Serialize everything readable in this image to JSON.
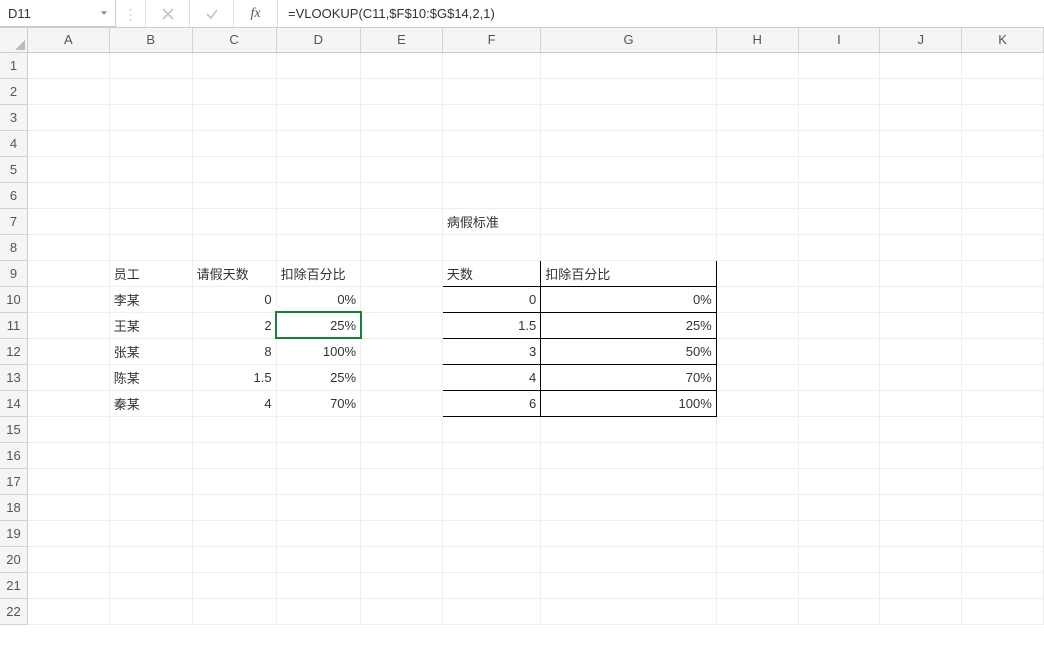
{
  "nameBox": "D11",
  "formula": "=VLOOKUP(C11,$F$10:$G$14,2,1)",
  "columns": [
    "A",
    "B",
    "C",
    "D",
    "E",
    "F",
    "G",
    "H",
    "I",
    "J",
    "K"
  ],
  "rowCount": 22,
  "selectedCell": {
    "row": 11,
    "col": "D"
  },
  "cells": {
    "F7": {
      "v": "病假标准",
      "align": "left"
    },
    "B9": {
      "v": "员工",
      "align": "left"
    },
    "C9": {
      "v": "请假天数",
      "align": "left"
    },
    "D9": {
      "v": "扣除百分比",
      "align": "left"
    },
    "F9": {
      "v": "天数",
      "align": "left",
      "border": [
        "bt",
        "bl",
        "br",
        "bb"
      ]
    },
    "G9": {
      "v": "扣除百分比",
      "align": "left",
      "border": [
        "bt",
        "br",
        "bb"
      ]
    },
    "B10": {
      "v": "李某",
      "align": "left"
    },
    "C10": {
      "v": "0",
      "align": "right"
    },
    "D10": {
      "v": "0%",
      "align": "right"
    },
    "F10": {
      "v": "0",
      "align": "right",
      "border": [
        "bl",
        "br",
        "bb"
      ]
    },
    "G10": {
      "v": "0%",
      "align": "right",
      "border": [
        "br",
        "bb"
      ]
    },
    "B11": {
      "v": "王某",
      "align": "left"
    },
    "C11": {
      "v": "2",
      "align": "right"
    },
    "D11": {
      "v": "25%",
      "align": "right"
    },
    "F11": {
      "v": "1.5",
      "align": "right",
      "border": [
        "bl",
        "br",
        "bb"
      ]
    },
    "G11": {
      "v": "25%",
      "align": "right",
      "border": [
        "br",
        "bb"
      ]
    },
    "B12": {
      "v": "张某",
      "align": "left"
    },
    "C12": {
      "v": "8",
      "align": "right"
    },
    "D12": {
      "v": "100%",
      "align": "right"
    },
    "F12": {
      "v": "3",
      "align": "right",
      "border": [
        "bl",
        "br",
        "bb"
      ]
    },
    "G12": {
      "v": "50%",
      "align": "right",
      "border": [
        "br",
        "bb"
      ]
    },
    "B13": {
      "v": "陈某",
      "align": "left"
    },
    "C13": {
      "v": "1.5",
      "align": "right"
    },
    "D13": {
      "v": "25%",
      "align": "right"
    },
    "F13": {
      "v": "4",
      "align": "right",
      "border": [
        "bl",
        "br",
        "bb"
      ]
    },
    "G13": {
      "v": "70%",
      "align": "right",
      "border": [
        "br",
        "bb"
      ]
    },
    "B14": {
      "v": "秦某",
      "align": "left"
    },
    "C14": {
      "v": "4",
      "align": "right"
    },
    "D14": {
      "v": "70%",
      "align": "right"
    },
    "F14": {
      "v": "6",
      "align": "right",
      "border": [
        "bl",
        "br",
        "bb"
      ]
    },
    "G14": {
      "v": "100%",
      "align": "right",
      "border": [
        "br",
        "bb"
      ]
    }
  }
}
